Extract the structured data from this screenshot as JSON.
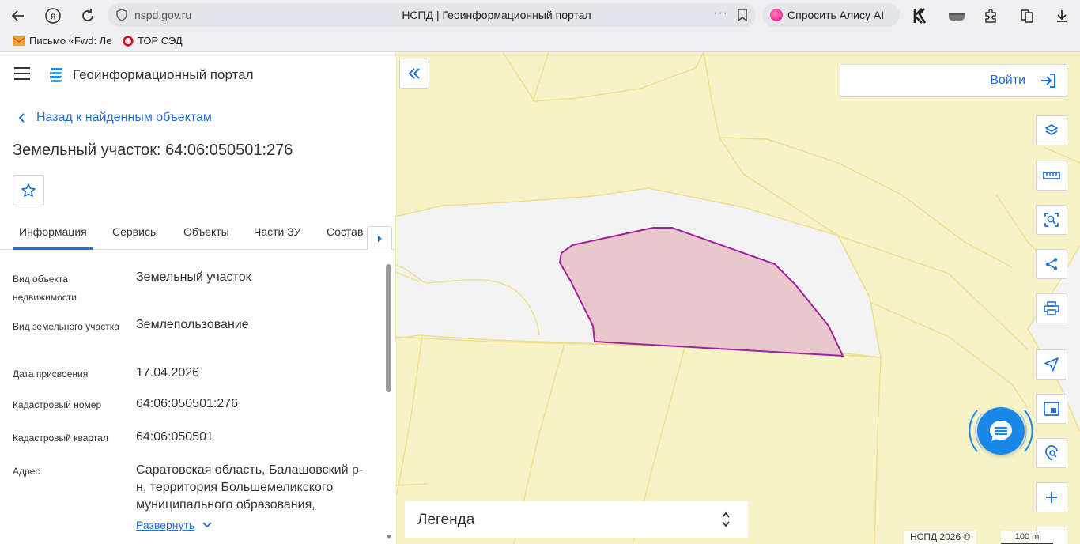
{
  "browser": {
    "url": "nspd.gov.ru",
    "tab_title": "НСПД | Геоинформационный портал",
    "alice_label": "Спросить Алису AI",
    "bookmarks": [
      {
        "label": "Письмо «Fwd: Лес",
        "icon": "mail-icon"
      },
      {
        "label": "ТОР СЭД",
        "icon": "red-circle-icon"
      }
    ]
  },
  "panel": {
    "portal_name": "Геоинформационный портал",
    "back_label": "Назад к найденным объектам",
    "title": "Земельный участок: 64:06:050501:276",
    "tabs": [
      {
        "label": "Информация",
        "active": true
      },
      {
        "label": "Сервисы",
        "active": false
      },
      {
        "label": "Объекты",
        "active": false
      },
      {
        "label": "Части ЗУ",
        "active": false
      },
      {
        "label": "Состав",
        "active": false
      }
    ],
    "properties": [
      {
        "label": "Вид объекта недвижимости",
        "value": "Земельный участок"
      },
      {
        "label": "Вид земельного участка",
        "value": "Землепользование"
      },
      {
        "label": "Дата присвоения",
        "value": "17.04.2026"
      },
      {
        "label": "Кадастровый номер",
        "value": "64:06:050501:276"
      },
      {
        "label": "Кадастровый квартал",
        "value": "64:06:050501"
      },
      {
        "label": "Адрес",
        "value": "Саратовская область, Балашовский р-н, территория Большемеликского муниципального образования,"
      }
    ],
    "expand_label": "Развернуть"
  },
  "map": {
    "login_label": "Войти",
    "legend_label": "Легенда",
    "copyright": "НСПД 2026 ©",
    "scale_label": "100 m",
    "colors": {
      "land": "#f8f2c8",
      "boundary": "#ecdf8a",
      "road": "#f3f3f3",
      "parcel_fill": "#e8c8cc",
      "parcel_stroke": "#a020a0",
      "accent": "#1f6fd6"
    },
    "tools": [
      "layers-icon",
      "ruler-icon",
      "select-area-icon",
      "share-icon",
      "print-icon",
      "locate-icon",
      "minimap-icon",
      "search-location-icon",
      "zoom-in-icon"
    ]
  }
}
